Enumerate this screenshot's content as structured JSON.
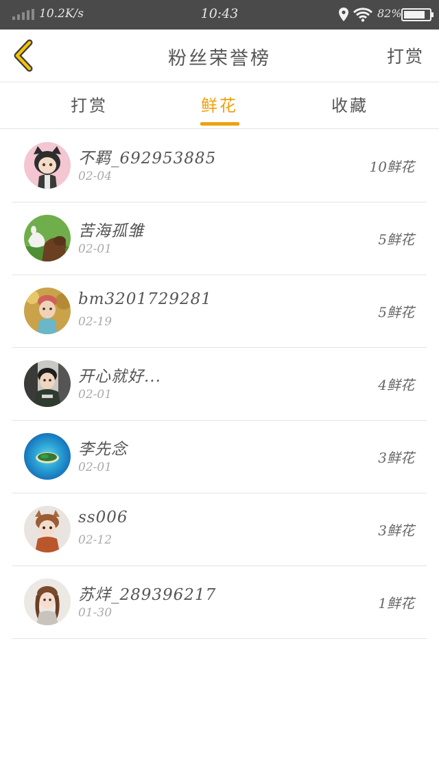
{
  "status_bar": {
    "network_speed": "10.2K/s",
    "time": "10:43",
    "battery": "82%",
    "battery_level": 0.82
  },
  "nav": {
    "title": "粉丝荣誉榜",
    "action_label": "打赏"
  },
  "tabs": [
    {
      "label": "打赏"
    },
    {
      "label": "鲜花"
    },
    {
      "label": "收藏"
    }
  ],
  "active_tab": "鲜花",
  "accent_color": "#f0a00c",
  "fans": [
    {
      "name": "不羁_692953885",
      "date": "02-04",
      "amount": "10鲜花"
    },
    {
      "name": "苦海孤雏",
      "date": "02-01",
      "amount": "5鲜花"
    },
    {
      "name": "bm3201729281",
      "date": "02-19",
      "amount": "5鲜花"
    },
    {
      "name": "开心就好...",
      "date": "02-01",
      "amount": "4鲜花"
    },
    {
      "name": "李先念",
      "date": "02-01",
      "amount": "3鲜花"
    },
    {
      "name": "ss006",
      "date": "02-12",
      "amount": "3鲜花"
    },
    {
      "name": "苏烊_289396217",
      "date": "01-30",
      "amount": "1鲜花"
    }
  ]
}
